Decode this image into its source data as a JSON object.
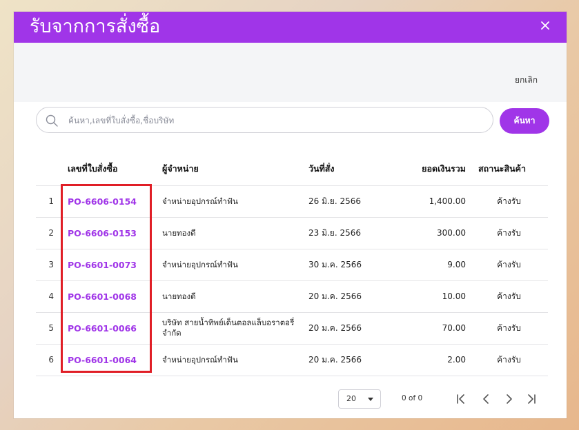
{
  "dialog": {
    "title": "รับจากการสั่งซื้อ",
    "cancel_label": "ยกเลิก"
  },
  "search": {
    "placeholder": "ค้นหา,เลขที่ใบสั่งซื้อ,ชื่อบริษัท",
    "value": "",
    "button_label": "ค้นหา"
  },
  "table": {
    "headers": {
      "po_no": "เลขที่ใบสั่งซื้อ",
      "vendor": "ผู้จำหน่าย",
      "date": "วันที่สั่ง",
      "amount": "ยอดเงินรวม",
      "status": "สถานะสินค้า"
    },
    "rows": [
      {
        "idx": "1",
        "po_no": "PO-6606-0154",
        "vendor": "จำหน่ายอุปกรณ์ทำฟัน",
        "date": "26 มิ.ย. 2566",
        "amount": "1,400.00",
        "status": "ค้างรับ"
      },
      {
        "idx": "2",
        "po_no": "PO-6606-0153",
        "vendor": "นายทองดี",
        "date": "23 มิ.ย. 2566",
        "amount": "300.00",
        "status": "ค้างรับ"
      },
      {
        "idx": "3",
        "po_no": "PO-6601-0073",
        "vendor": "จำหน่ายอุปกรณ์ทำฟัน",
        "date": "30 ม.ค. 2566",
        "amount": "9.00",
        "status": "ค้างรับ"
      },
      {
        "idx": "4",
        "po_no": "PO-6601-0068",
        "vendor": "นายทองดี",
        "date": "20 ม.ค. 2566",
        "amount": "10.00",
        "status": "ค้างรับ"
      },
      {
        "idx": "5",
        "po_no": "PO-6601-0066",
        "vendor": "บริษัท สายน้ำทิพย์เด็นตอลแล็บอราตอรี่ จำกัด",
        "date": "20 ม.ค. 2566",
        "amount": "70.00",
        "status": "ค้างรับ"
      },
      {
        "idx": "6",
        "po_no": "PO-6601-0064",
        "vendor": "จำหน่ายอุปกรณ์ทำฟัน",
        "date": "20 ม.ค. 2566",
        "amount": "2.00",
        "status": "ค้างรับ"
      }
    ]
  },
  "pagination": {
    "page_size": "20",
    "range_text": "0 of 0"
  },
  "colors": {
    "accent": "#a035e8",
    "highlight": "#e01e26"
  },
  "icons": [
    "close-icon",
    "search-icon",
    "first-page-icon",
    "prev-page-icon",
    "next-page-icon",
    "last-page-icon"
  ]
}
